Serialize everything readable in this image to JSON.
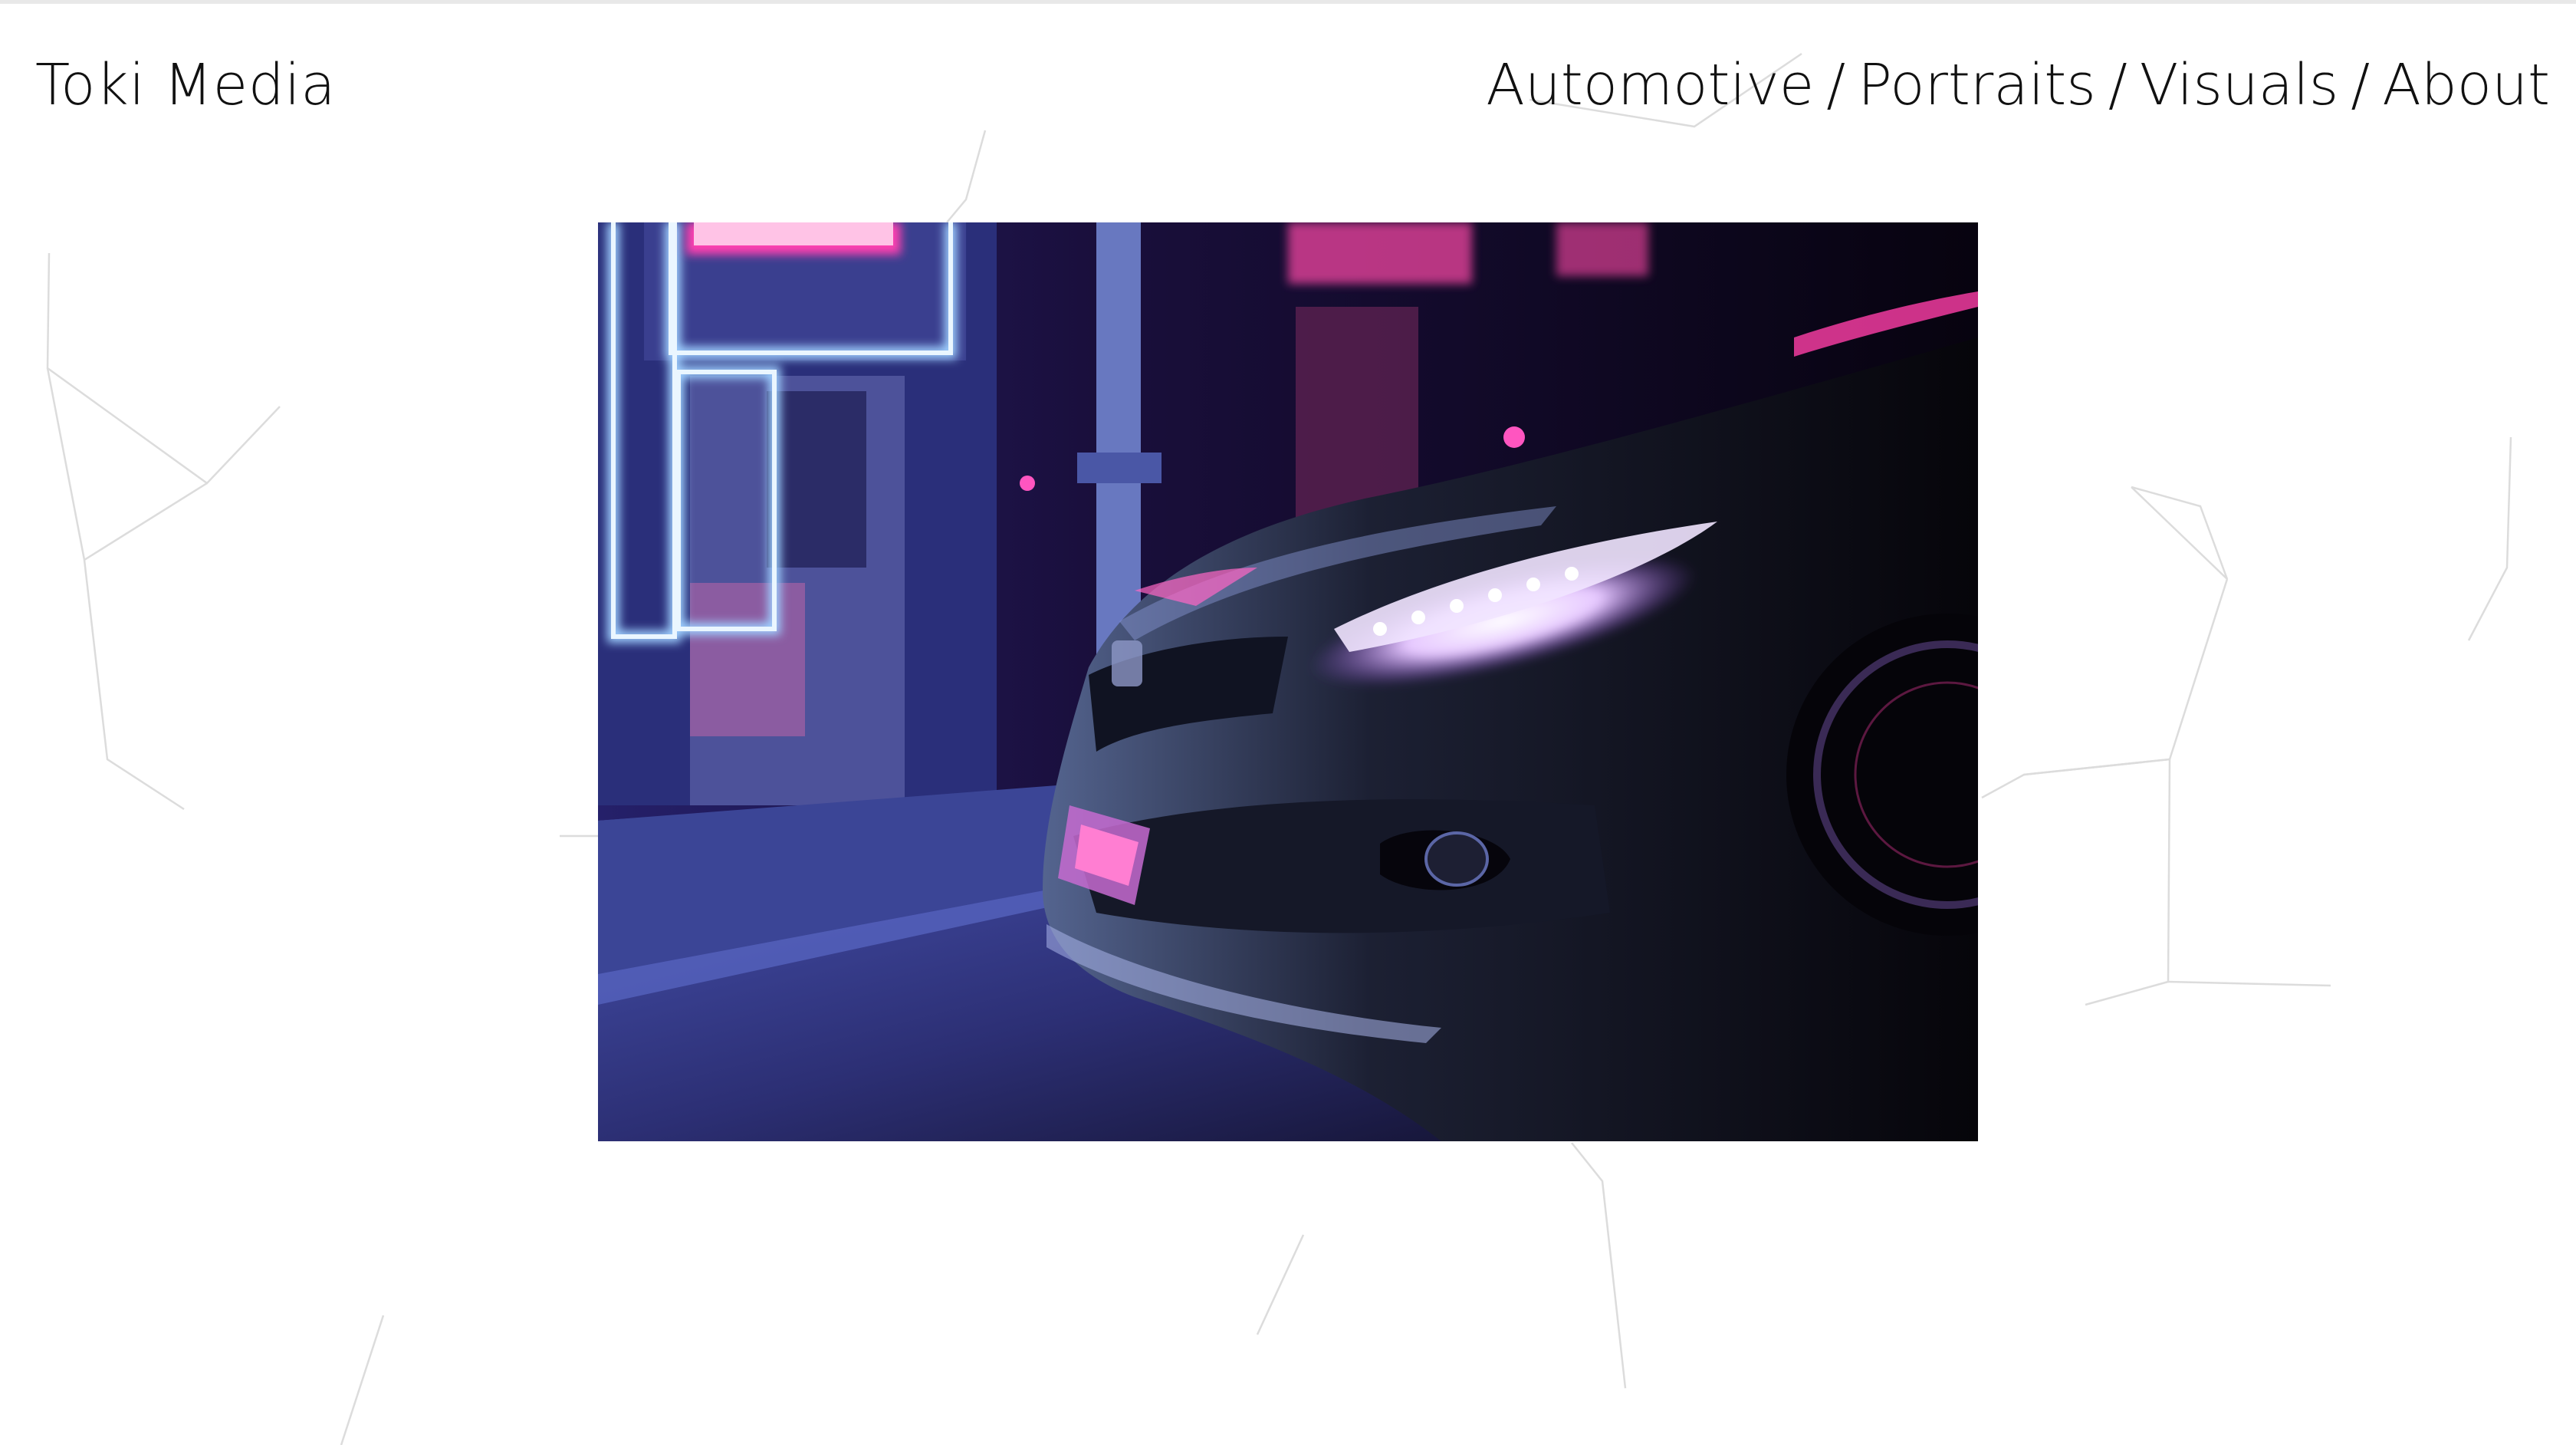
{
  "header": {
    "brand": "Toki Media",
    "nav": {
      "automotive": "Automotive",
      "portraits": "Portraits",
      "visuals": "Visuals",
      "about": "About",
      "separator": "/"
    }
  },
  "hero": {
    "subject": "car-photo",
    "colors": {
      "neon_blue": "#7fb4ff",
      "neon_pink": "#ff3fb0",
      "night": "#0b0618",
      "street": "#3a3f8a"
    }
  },
  "background": {
    "line_color": "#d9d9d9"
  }
}
